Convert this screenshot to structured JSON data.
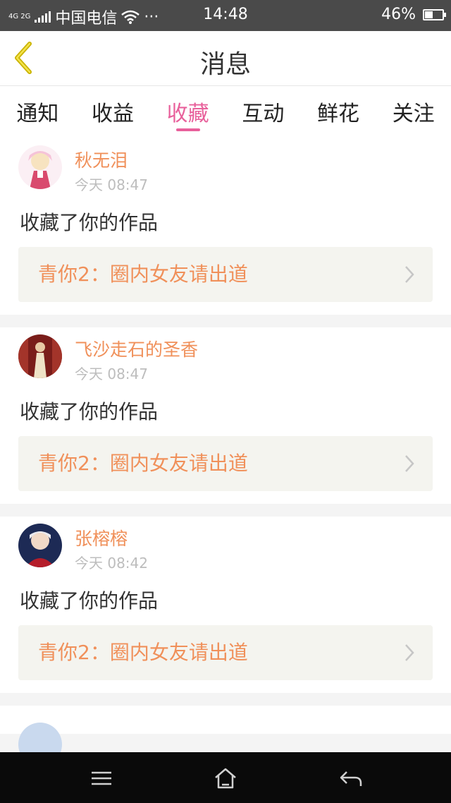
{
  "status_bar": {
    "network": "4G 2G",
    "carrier": "中国电信",
    "more": "···",
    "time": "14:48",
    "battery_percent": "46%",
    "battery_level": 0.46
  },
  "nav": {
    "title": "消息"
  },
  "tabs": [
    {
      "label": "通知",
      "active": false
    },
    {
      "label": "收益",
      "active": false
    },
    {
      "label": "收藏",
      "active": true
    },
    {
      "label": "互动",
      "active": false
    },
    {
      "label": "鲜花",
      "active": false
    },
    {
      "label": "关注",
      "active": false
    }
  ],
  "messages": [
    {
      "username": "秋无泪",
      "time": "今天 08:47",
      "action": "收藏了你的作品",
      "work_title": "青你2：圈内女友请出道"
    },
    {
      "username": "飞沙走石的圣香",
      "time": "今天 08:47",
      "action": "收藏了你的作品",
      "work_title": "青你2：圈内女友请出道"
    },
    {
      "username": "张榕榕",
      "time": "今天 08:42",
      "action": "收藏了你的作品",
      "work_title": "青你2：圈内女友请出道"
    }
  ],
  "colors": {
    "accent_pink": "#e8609b",
    "name_orange": "#f0905a"
  }
}
